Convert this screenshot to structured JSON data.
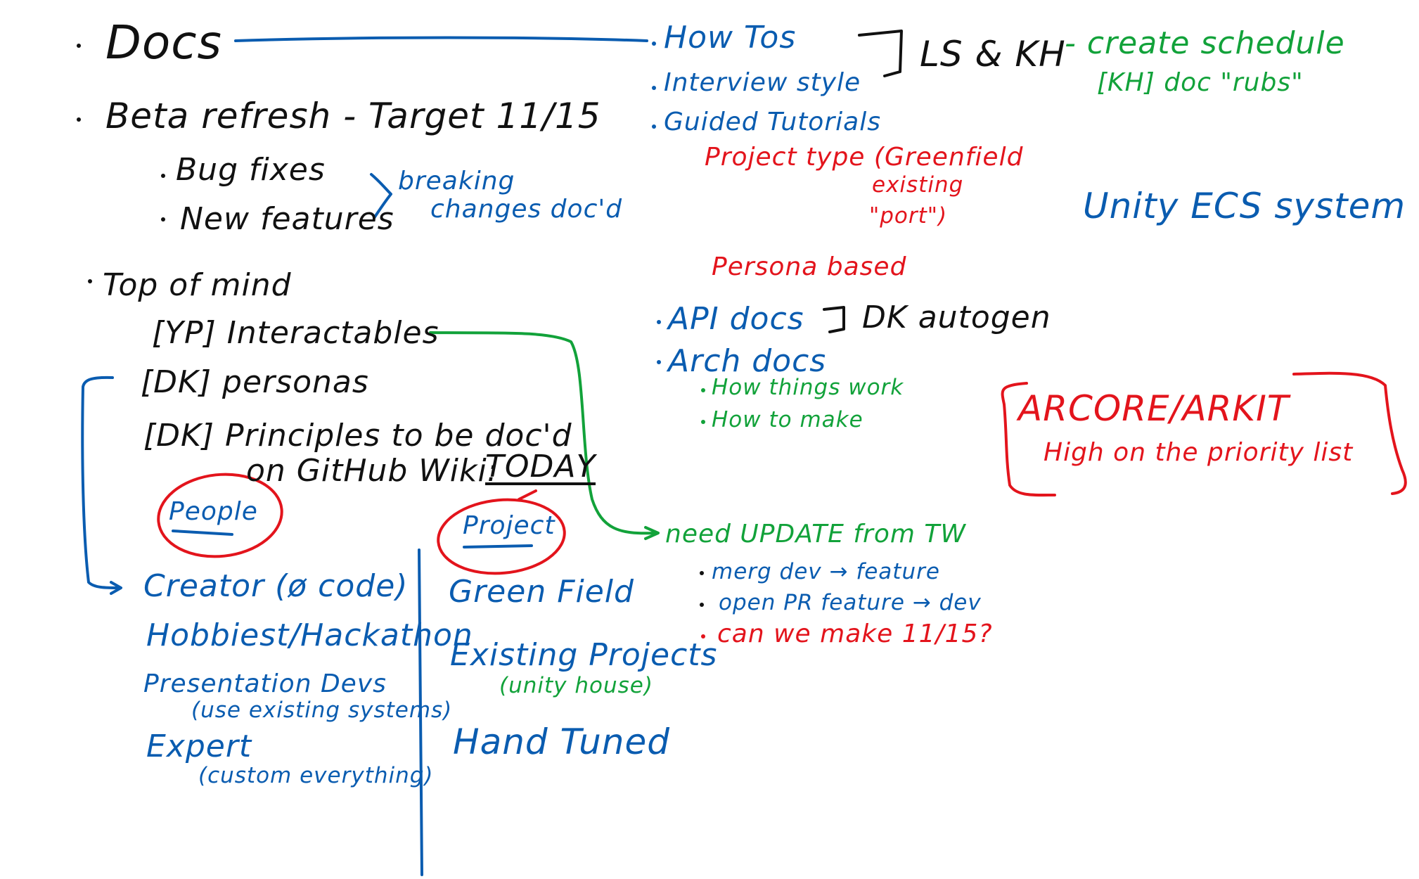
{
  "colors": {
    "black": "#111111",
    "blue": "#0a5cb0",
    "green": "#12a23a",
    "red": "#e3141c"
  },
  "left": {
    "docs": "Docs",
    "beta": "Beta refresh - Target 11/15",
    "bug_fixes": "Bug fixes",
    "new_features": "New features",
    "breaking_1": "breaking",
    "breaking_2": "changes doc'd",
    "top_of_mind": "Top of mind",
    "yp_interactables": "[YP] Interactables",
    "dk_personas": "[DK] personas",
    "dk_principles_1": "[DK] Principles to be doc'd",
    "dk_principles_2": "on GitHub Wiki:",
    "today": "TODAY",
    "people": "People",
    "project": "Project",
    "people_items": {
      "creator": "Creator (ø code)",
      "hobbiest": "Hobbiest/Hackathon",
      "presentation": "Presentation Devs",
      "presentation_note": "(use existing systems)",
      "expert": "Expert",
      "expert_note": "(custom everything)"
    },
    "project_items": {
      "green_field": "Green Field",
      "existing": "Existing Projects",
      "existing_note": "(unity house)",
      "hand_tuned": "Hand Tuned"
    }
  },
  "right": {
    "how_tos": "How Tos",
    "interview_style": "Interview style",
    "guided_tutorials": "Guided Tutorials",
    "ls_kh": "LS & KH",
    "create_schedule": "- create schedule",
    "kh_doc_rubs": "[KH] doc \"rubs\"",
    "project_type_1": "Project type (Greenfield",
    "project_type_2": "existing",
    "project_type_3": "\"port\")",
    "unity_ecs": "Unity ECS system",
    "persona_based": "Persona based",
    "api_docs": "API docs",
    "dk_autogen": "DK autogen",
    "arch_docs": "Arch docs",
    "how_things_work": "How things work",
    "how_to_make": "How to make",
    "arcore": "ARCORE/ARKIT",
    "priority": "High on the priority list",
    "need_update": "need UPDATE from TW",
    "merg": "merg dev → feature",
    "open_pr": "open PR feature → dev",
    "can_we": "can we make 11/15?"
  }
}
